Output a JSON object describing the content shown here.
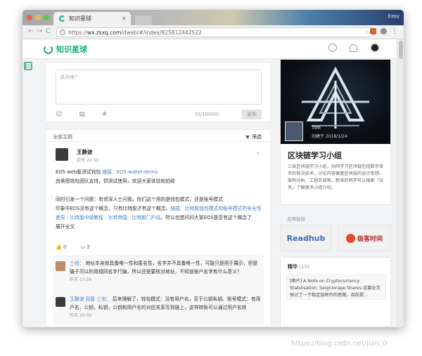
{
  "browser": {
    "tab_title": "知识星球",
    "tab_close": "×",
    "user_label": "Easy",
    "url_prefix": "https://",
    "url_host": "wx.zsxq.com",
    "url_path": "/dweb/#/index/825812442522",
    "back": "←",
    "forward": "→",
    "reload": "C",
    "star": "☆",
    "menu": "⋮",
    "info": "i"
  },
  "site": {
    "logo_text": "知识星球"
  },
  "composer": {
    "placeholder": "说点啥？",
    "emoji_icon": "☺",
    "file_icon": "▤",
    "hash_icon": "#",
    "char_count": "(0/10000)",
    "publish_label": "发布"
  },
  "filterbar": {
    "label": "全部主题",
    "filter_label": "筛选"
  },
  "post": {
    "author": "王静波",
    "time": "前天 20:59",
    "chevron": "⌄",
    "line1_a": "EOS web版测试钱包 ",
    "line1_link_label": "链接：",
    "line1_link": "EOS-wallet-demo",
    "line2": "由美图钱包团队支持，供测试使用，欢迎大家体验和拍砖",
    "line3": "同时引发一个问题：有资深人士问我，你们这个用的是钱包模式，还是账号模式",
    "line4_a": "印象中EOS没有这个概念，只有比特股才有这个概念。",
    "line4_link": "链接：比特股钱包模式和账号模式的安全性差异 - 比特股中级教程 - 比特帝国 - 比特股门户站",
    "line4_b": "。所以也想问问大家EOS是否有这个概念了",
    "line_last": "展开全文",
    "likes": "0",
    "comments": "3"
  },
  "comments": [
    {
      "name": "三也：",
      "text": "地址本身就具备唯一性和匿名性，名字并不具备唯一性，可能只是用于展示，但是骗子可以利用相同名字行骗，所以还是要核对地址，不知道账户名字有什么意义？",
      "time": "昨天 13:26"
    },
    {
      "name": "王静波 回复 三也：",
      "text": "后来理解了，钱包模式：没有用户名，至于公钥私钥。账号模式：有用户名，公钥，私钥，公钥和用户名的对应关系写到链上，这样转账可以通过用户名转",
      "time": "昨天 20:09"
    }
  ],
  "group": {
    "creator": "Tim",
    "created": "创建于 2018/1/24",
    "title": "区块链学习小组",
    "desc": "三体区块链学习小组，共同学习区块链包括数字货币的前沿技术。讨论内容偏重区块链的设计思想、架构分析、工程实现等。新来的同学可以搜索「站务」了解更多小组介绍。"
  },
  "friends": {
    "title": "友情链接",
    "readhub": "Readhub",
    "jike": "极客时间"
  },
  "essence": {
    "title": "精华",
    "count": "(15)",
    "item": "[图片] A Note on Cryptocurrency Stabilisation: Seigniorage Shares 这篇论文探讨了一下稳定加密币的思路，目前提..."
  },
  "watermark": "https://blog.csdn.net/jian_0",
  "colors": {
    "brand": "#17b07d",
    "link": "#3f82c4"
  }
}
